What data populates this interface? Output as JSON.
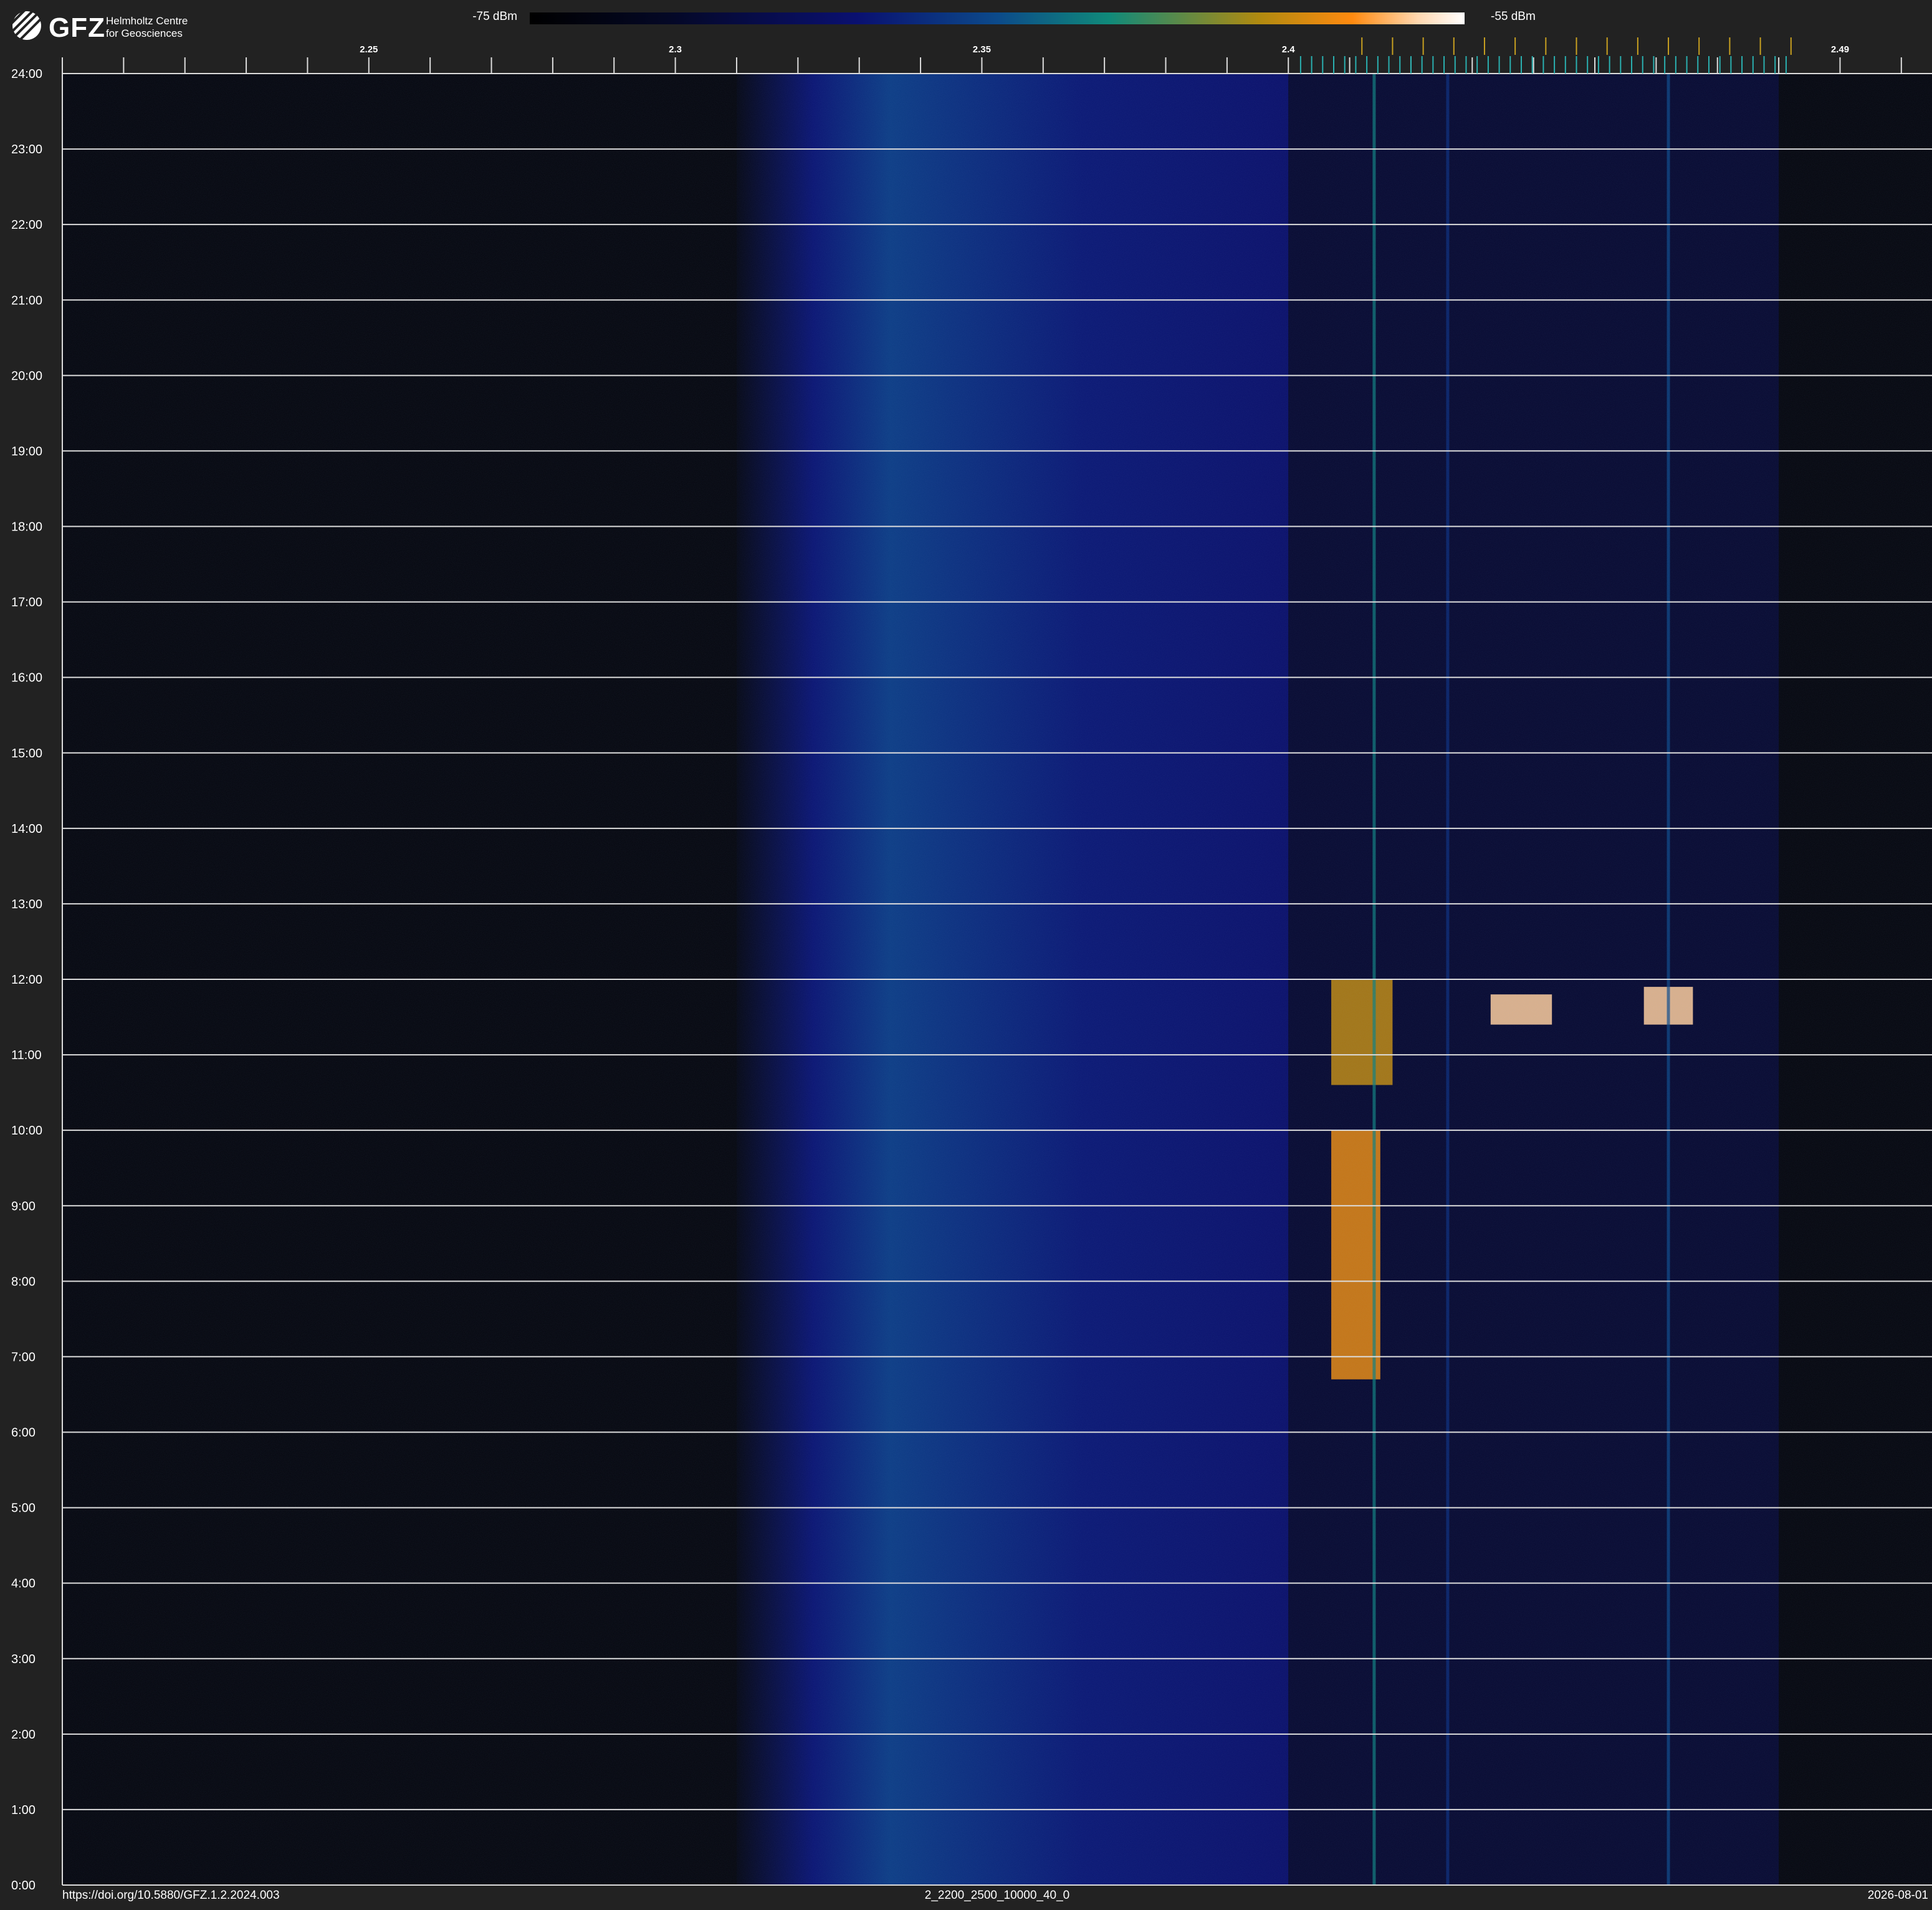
{
  "header": {
    "logo_text": "GFZ",
    "logo_subtitle_line1": "Helmholtz Centre",
    "logo_subtitle_line2": "for Geosciences",
    "colorbar_min_label": "-75 dBm",
    "colorbar_max_label": "-55 dBm"
  },
  "footer": {
    "doi": "https://doi.org/10.5880/GFZ.1.2.2024.003",
    "dataset_id": "2_2200_2500_10000_40_0",
    "date": "2026-08-01"
  },
  "colors": {
    "background": "#222222",
    "plot_background": "#05060d",
    "gridline": "#dddddd",
    "channel_tick_teal": "#2ab0b0",
    "channel_tick_gold": "#c8a020"
  },
  "chart_data": {
    "type": "heatmap",
    "title": "",
    "xlabel": "",
    "ylabel": "",
    "x_range": [
      2.2,
      2.5
    ],
    "x_tick_labels": [
      {
        "value": 2.25,
        "label": "2.25"
      },
      {
        "value": 2.3,
        "label": "2.3"
      },
      {
        "value": 2.35,
        "label": "2.35"
      },
      {
        "value": 2.4,
        "label": "2.4"
      },
      {
        "value": 2.49,
        "label": "2.49"
      }
    ],
    "x_minor_tick_step": 0.01,
    "y_range_hours": [
      0,
      24
    ],
    "y_tick_labels": [
      "0:00",
      "1:00",
      "2:00",
      "3:00",
      "4:00",
      "5:00",
      "6:00",
      "7:00",
      "8:00",
      "9:00",
      "10:00",
      "11:00",
      "12:00",
      "13:00",
      "14:00",
      "15:00",
      "16:00",
      "17:00",
      "18:00",
      "19:00",
      "20:00",
      "21:00",
      "22:00",
      "23:00",
      "24:00"
    ],
    "grid": true,
    "colorbar": {
      "min_dbm": -75,
      "max_dbm": -55
    },
    "features": [
      {
        "name": "broad noise band",
        "x_start": 2.31,
        "x_end": 2.4,
        "x_peak": 2.335,
        "level": 0.45,
        "t_start": 0,
        "t_end": 24
      },
      {
        "name": "activity region",
        "x_start": 2.4,
        "x_end": 2.48,
        "t_start": 0,
        "t_end": 24
      },
      {
        "name": "strong burst",
        "x_start": 2.407,
        "x_end": 2.415,
        "t_start": 6.7,
        "t_end": 10.0,
        "level": 0.85
      },
      {
        "name": "strong burst",
        "x_start": 2.407,
        "x_end": 2.417,
        "t_start": 10.6,
        "t_end": 12.0,
        "level": 0.8
      },
      {
        "name": "strong burst",
        "x_start": 2.433,
        "x_end": 2.443,
        "t_start": 11.4,
        "t_end": 11.8,
        "level": 0.95
      },
      {
        "name": "strong burst",
        "x_start": 2.458,
        "x_end": 2.466,
        "t_start": 11.4,
        "t_end": 11.9,
        "level": 0.95
      },
      {
        "name": "channel line",
        "x": 2.414,
        "level": 0.6
      },
      {
        "name": "channel line",
        "x": 2.426,
        "level": 0.4
      },
      {
        "name": "channel line",
        "x": 2.462,
        "level": 0.5
      }
    ]
  }
}
